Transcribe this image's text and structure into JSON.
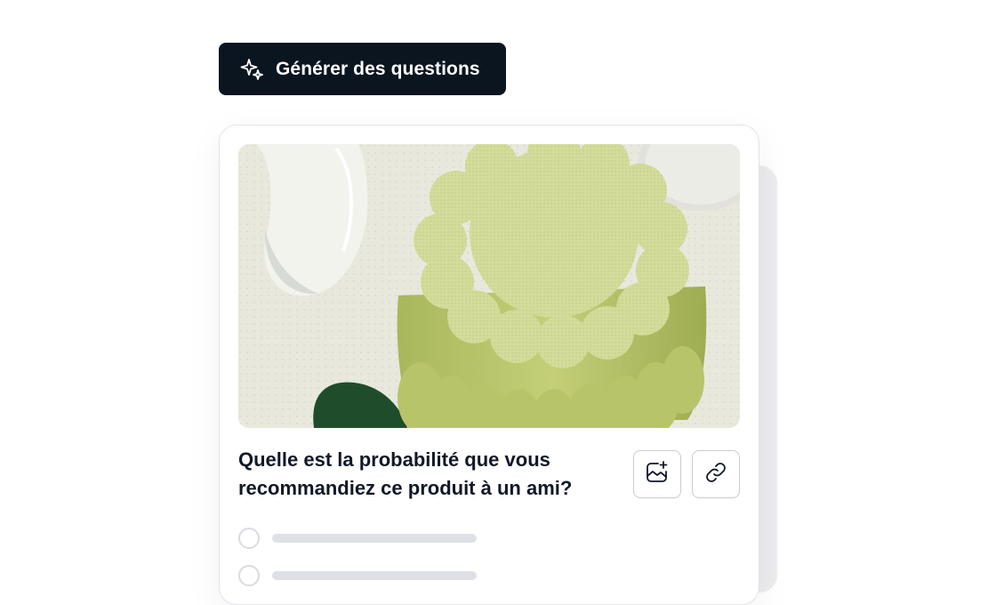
{
  "generate_button": {
    "label": "Générer des questions",
    "icon": "sparkles-icon"
  },
  "card": {
    "image_alt": "Green scalloped flower-shaped sculpture on a dotted pale surface",
    "question": "Quelle est la probabilité que vous recommandiez ce produit à un ami?",
    "actions": [
      {
        "name": "add-image-button",
        "icon": "image-add-icon"
      },
      {
        "name": "link-button",
        "icon": "link-icon"
      }
    ],
    "options": [
      {
        "placeholder": true
      },
      {
        "placeholder": true
      }
    ]
  },
  "colors": {
    "button_bg": "#0b1520",
    "border": "#e3e4e8",
    "placeholder_bar": "#dfe0e6",
    "flower": "#c9d58a"
  }
}
